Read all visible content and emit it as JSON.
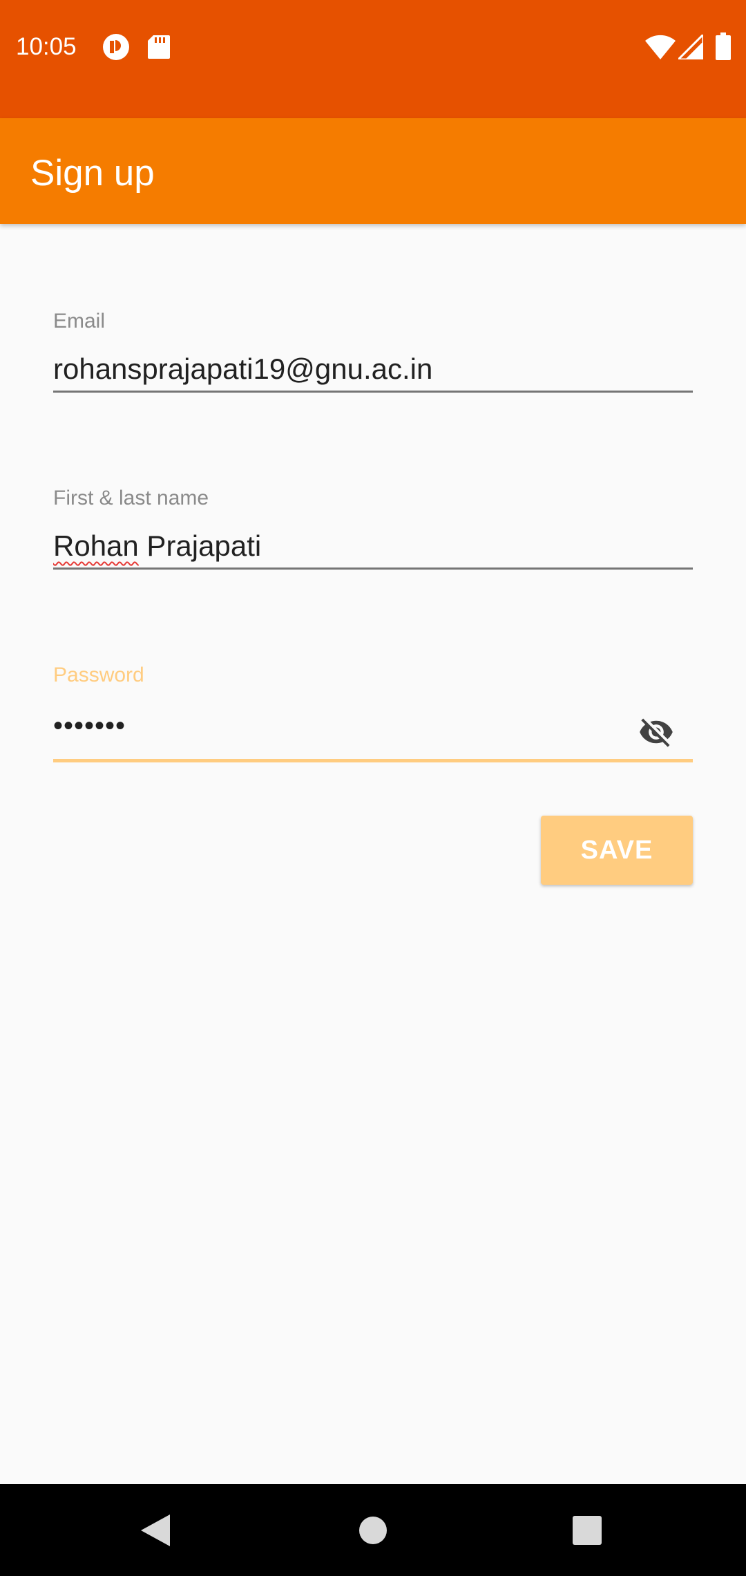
{
  "status_bar": {
    "time": "10:05",
    "background": "#e65100",
    "left_icons": [
      "notification-app-icon",
      "sd-card-icon"
    ],
    "right_icons": [
      "wifi-icon",
      "cell-signal-icon",
      "battery-icon"
    ]
  },
  "app_bar": {
    "title": "Sign up",
    "background": "#f57c00"
  },
  "form": {
    "email": {
      "label": "Email",
      "value": "rohansprajapati19@gnu.ac.in"
    },
    "name": {
      "label": "First & last name",
      "value_first": "Rohan",
      "value_rest": " Prajapati"
    },
    "password": {
      "label": "Password",
      "value": "•••••••",
      "toggle_icon": "visibility-off-icon",
      "focused": true,
      "accent": "#ffcc80"
    },
    "save_label": "SAVE"
  },
  "nav_bar": {
    "buttons": [
      "back-icon",
      "home-icon",
      "recents-icon"
    ]
  }
}
